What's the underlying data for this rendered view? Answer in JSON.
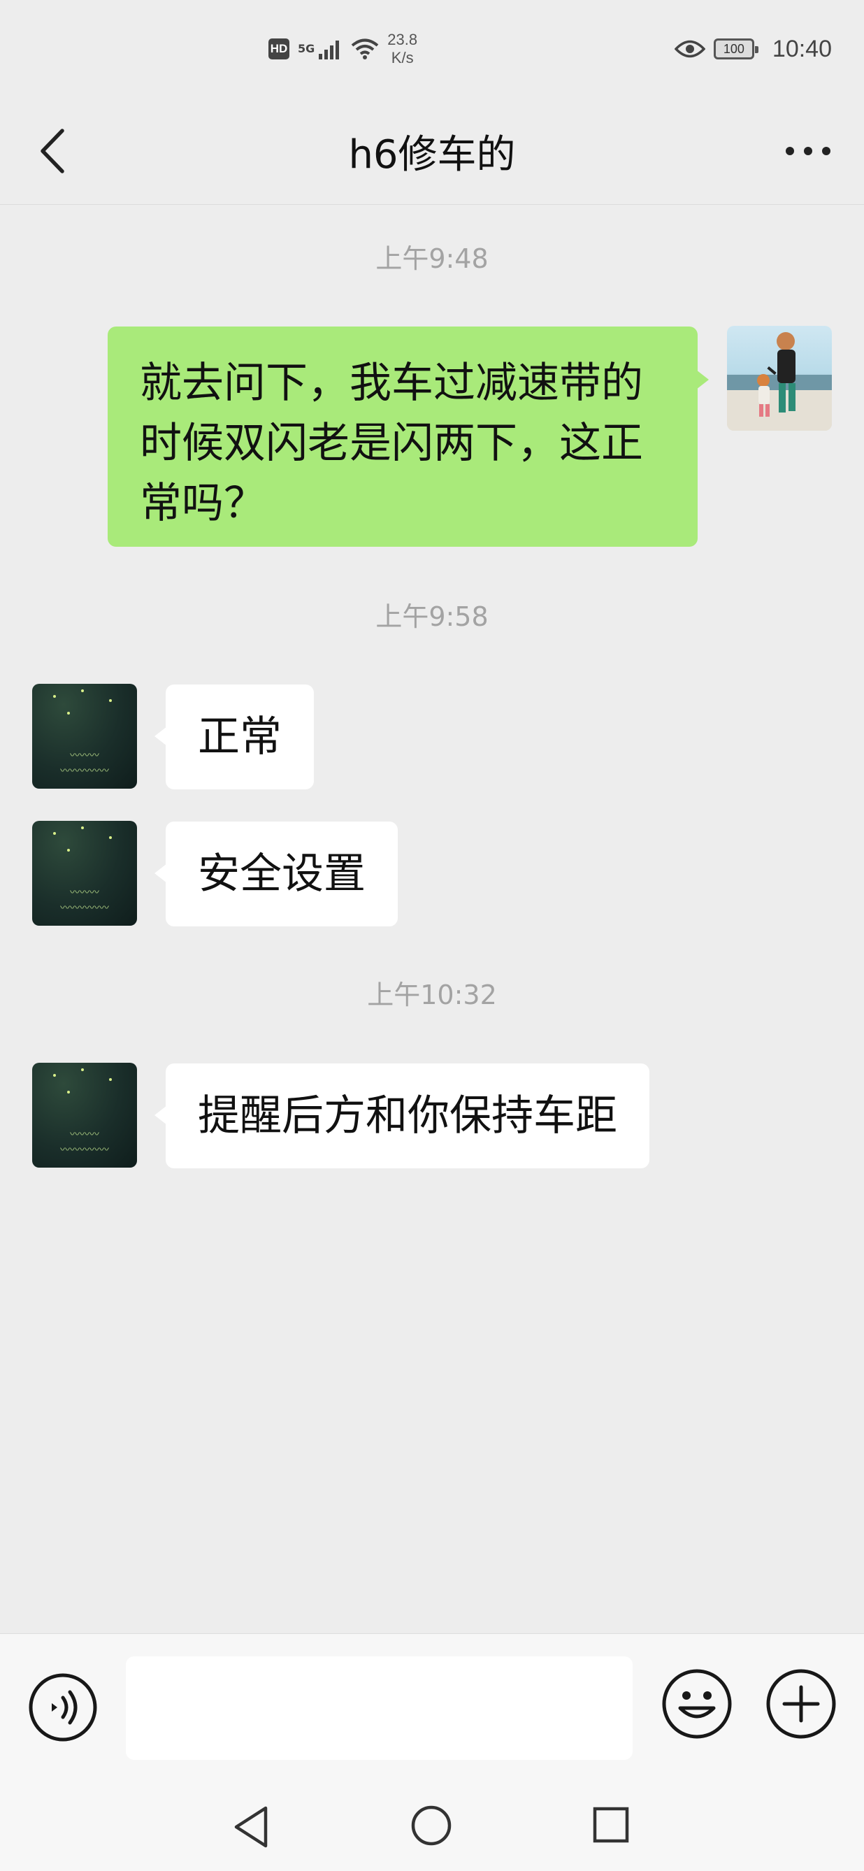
{
  "status_bar": {
    "hd": "HD",
    "network": "5G",
    "speed_value": "23.8",
    "speed_unit": "K/s",
    "battery": "100",
    "time": "10:40",
    "icons": [
      "hd-icon",
      "signal-icon",
      "wifi-icon",
      "eye-icon",
      "battery-icon"
    ]
  },
  "header": {
    "title": "h6修车的",
    "back_icon": "chevron-left-icon",
    "more_icon": "more-dots-icon"
  },
  "messages": [
    {
      "timestamp": "上午9:48"
    },
    {
      "sender": "me",
      "text_lines": [
        "就去问下，我车过减速带的",
        "时候双闪老是闪两下，这正",
        "常吗？"
      ]
    },
    {
      "timestamp": "上午9:58"
    },
    {
      "sender": "other",
      "text": "正常"
    },
    {
      "sender": "other",
      "text": "安全设置"
    },
    {
      "timestamp": "上午10:32"
    },
    {
      "sender": "other",
      "text": "提醒后方和你保持车距"
    }
  ],
  "input_bar": {
    "value": "",
    "placeholder": "",
    "voice_icon": "voice-icon",
    "emoji_icon": "emoji-icon",
    "plus_icon": "plus-icon"
  },
  "system_nav": {
    "icons": [
      "nav-back-icon",
      "nav-home-icon",
      "nav-recent-icon"
    ]
  },
  "colors": {
    "background": "#ededed",
    "my_bubble": "#a9ea7a",
    "other_bubble": "#ffffff",
    "timestamp": "#a3a3a3"
  }
}
